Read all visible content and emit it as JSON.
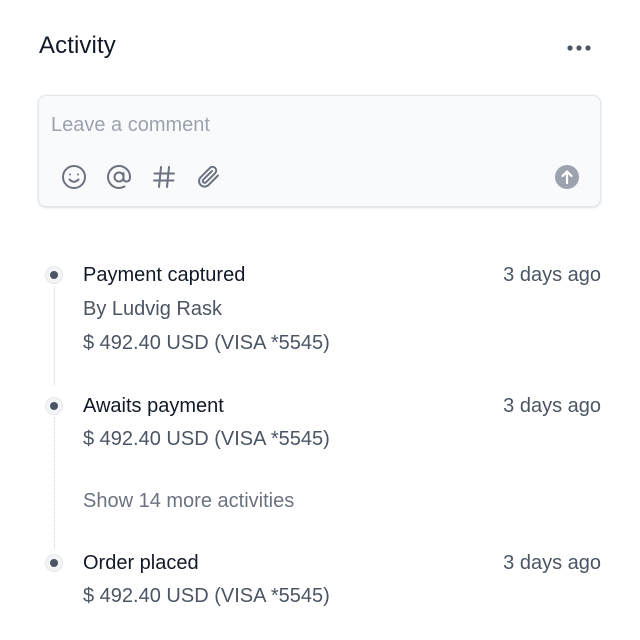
{
  "header": {
    "title": "Activity",
    "more_icon": "more-horizontal-icon"
  },
  "composer": {
    "placeholder": "Leave a comment",
    "tools": [
      "emoji-icon",
      "at-sign-icon",
      "hash-icon",
      "paperclip-icon"
    ],
    "send_icon": "arrow-up-circle-icon"
  },
  "events": [
    {
      "title": "Payment captured",
      "time": "3 days ago",
      "lines": [
        "By Ludvig Rask",
        "$ 492.40 USD (VISA *5545)"
      ]
    },
    {
      "title": "Awaits payment",
      "time": "3 days ago",
      "lines": [
        "$ 492.40 USD (VISA *5545)"
      ]
    },
    {
      "title": "Order placed",
      "time": "3 days ago",
      "lines": [
        "$ 492.40 USD (VISA *5545)"
      ]
    }
  ],
  "show_more": "Show 14 more activities",
  "colors": {
    "text_primary": "#111827",
    "text_secondary": "#4b5563",
    "placeholder": "#9ca3af",
    "icon": "#6b7280",
    "border": "#e5e7eb"
  }
}
